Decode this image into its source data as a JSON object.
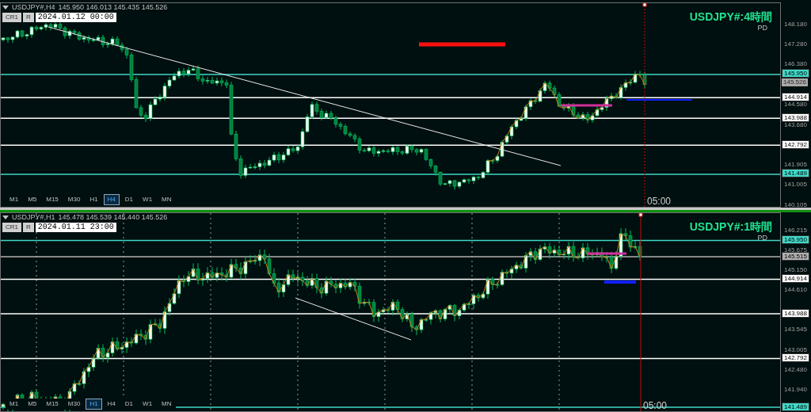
{
  "panels": [
    {
      "active": false,
      "symbol": "USDJPY#,H4",
      "quote": "145.950 146.013 145.435 145.526",
      "buttons": [
        "CR1",
        "R"
      ],
      "datetime": "2024.01.12 00:00",
      "title": "USDJPY#:4時間",
      "subtitle": "PD",
      "time_label": "05:00",
      "timeframes": [
        {
          "label": "M1",
          "selected": false
        },
        {
          "label": "M5",
          "selected": false
        },
        {
          "label": "M15",
          "selected": false
        },
        {
          "label": "M30",
          "selected": false
        },
        {
          "label": "H1",
          "selected": false
        },
        {
          "label": "H4",
          "selected": true
        },
        {
          "label": "D1",
          "selected": false
        },
        {
          "label": "W1",
          "selected": false
        },
        {
          "label": "MN",
          "selected": false
        }
      ],
      "axis": [
        {
          "price": "148.180",
          "kind": "tick"
        },
        {
          "price": "147.280",
          "kind": "tick"
        },
        {
          "price": "146.380",
          "kind": "tick"
        },
        {
          "price": "145.950",
          "kind": "line",
          "color": "#40d8c8"
        },
        {
          "price": "145.526",
          "kind": "bid"
        },
        {
          "price": "144.914",
          "kind": "line",
          "color": "#ffffff"
        },
        {
          "price": "144.580",
          "kind": "tick"
        },
        {
          "price": "143.988",
          "kind": "line",
          "color": "#ffffff"
        },
        {
          "price": "143.680",
          "kind": "tick"
        },
        {
          "price": "142.792",
          "kind": "line",
          "color": "#ffffff"
        },
        {
          "price": "141.905",
          "kind": "tick"
        },
        {
          "price": "141.489",
          "kind": "line",
          "color": "#40d8c8"
        },
        {
          "price": "141.005",
          "kind": "tick"
        },
        {
          "price": "140.105",
          "kind": "tick"
        }
      ]
    },
    {
      "active": true,
      "symbol": "USDJPY#,H1",
      "quote": "145.478 145.539 145.440 145.526",
      "buttons": [
        "CR1",
        "R"
      ],
      "datetime": "2024.01.11 23:00",
      "title": "USDJPY#:1時間",
      "subtitle": "PD",
      "time_label": "05:00",
      "timeframes": [
        {
          "label": "M1",
          "selected": false
        },
        {
          "label": "M5",
          "selected": false
        },
        {
          "label": "M15",
          "selected": false
        },
        {
          "label": "M30",
          "selected": false
        },
        {
          "label": "H1",
          "selected": true
        },
        {
          "label": "H4",
          "selected": false
        },
        {
          "label": "D1",
          "selected": false
        },
        {
          "label": "W1",
          "selected": false
        },
        {
          "label": "MN",
          "selected": false
        }
      ],
      "axis": [
        {
          "price": "146.215",
          "kind": "tick"
        },
        {
          "price": "145.950",
          "kind": "line",
          "color": "#40d8c8"
        },
        {
          "price": "145.675",
          "kind": "tick"
        },
        {
          "price": "145.515",
          "kind": "line",
          "color": "#b0b0b0"
        },
        {
          "price": "145.150",
          "kind": "tick"
        },
        {
          "price": "144.914",
          "kind": "line",
          "color": "#ffffff"
        },
        {
          "price": "144.610",
          "kind": "tick"
        },
        {
          "price": "143.988",
          "kind": "line",
          "color": "#ffffff"
        },
        {
          "price": "143.545",
          "kind": "tick"
        },
        {
          "price": "143.005",
          "kind": "tick"
        },
        {
          "price": "142.792",
          "kind": "line",
          "color": "#ffffff"
        },
        {
          "price": "142.480",
          "kind": "tick"
        },
        {
          "price": "141.940",
          "kind": "tick"
        },
        {
          "price": "141.489",
          "kind": "line",
          "color": "#40d8c8"
        }
      ]
    }
  ]
}
